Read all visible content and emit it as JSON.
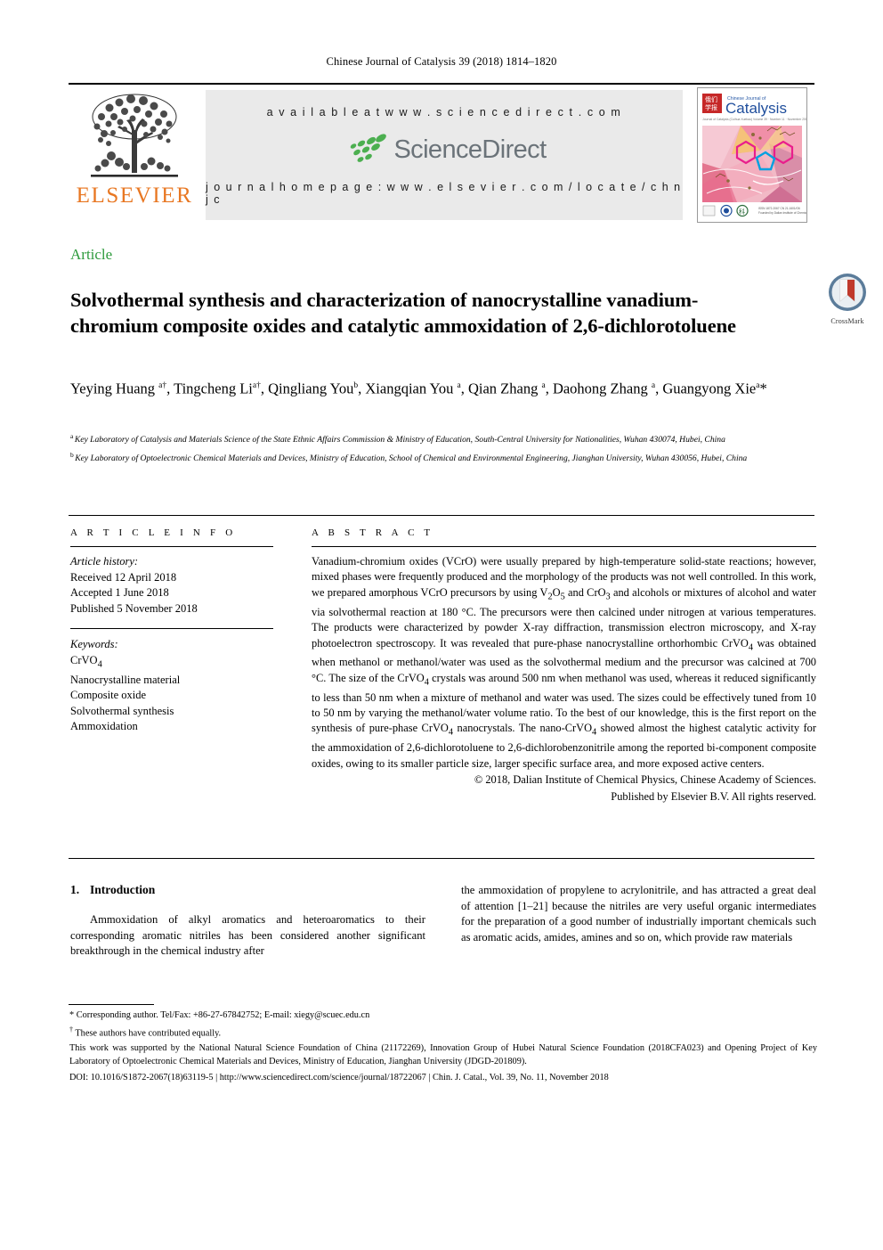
{
  "running_head": "Chinese Journal of Catalysis 39 (2018) 1814–1820",
  "masthead": {
    "publisher_name": "ELSEVIER",
    "available_at": "a v a i l a b l e   a t   w w w . s c i e n c e d i r e c t . c o m",
    "sciencedirect_logo_text": "ScienceDirect",
    "journal_homepage": "j o u r n a l   h o m e p a g e :   w w w . e l s e v i e r . c o m / l o c a t e / c h n j c",
    "cover_journal_title": "Catalysis",
    "cover_journal_kicker": "Chinese Journal of"
  },
  "article_type": "Article",
  "title": "Solvothermal synthesis and characterization of nanocrystalline vanadium-chromium composite oxides and catalytic ammoxidation of 2,6-dichlorotoluene",
  "crossmark_label": "CrossMark",
  "authors_html": "Yeying Huang <sup>a†</sup>, Tingcheng Li<sup>a†</sup>, Qingliang You<sup>b</sup>, Xiangqian You <sup>a</sup>, Qian Zhang <sup>a</sup>, Daohong Zhang <sup>a</sup>, Guangyong Xie<sup>a</sup>*",
  "affiliations": [
    {
      "marker": "a",
      "text": "Key Laboratory of Catalysis and Materials Science of the State Ethnic Affairs Commission & Ministry of Education, South-Central University for Nationalities, Wuhan 430074, Hubei, China"
    },
    {
      "marker": "b",
      "text": "Key Laboratory of Optoelectronic Chemical Materials and Devices, Ministry of Education, School of Chemical and Environmental Engineering, Jianghan University, Wuhan 430056, Hubei, China"
    }
  ],
  "article_info": {
    "heading": "A R T I C L E   I N F O",
    "history_label": "Article history:",
    "history": [
      "Received 12 April 2018",
      "Accepted 1 June 2018",
      "Published 5 November 2018"
    ],
    "keywords_label": "Keywords:",
    "keywords_html": [
      "CrVO<sub>4</sub>",
      "Nanocrystalline material",
      "Composite oxide",
      "Solvothermal synthesis",
      "Ammoxidation"
    ]
  },
  "abstract": {
    "heading": "A B S T R A C T",
    "body_html": "Vanadium-chromium oxides (VCrO) were usually prepared by high-temperature solid-state reactions; however, mixed phases were frequently produced and the morphology of the products was not well controlled. In this work, we prepared amorphous VCrO precursors by using V<sub>2</sub>O<sub>5</sub> and CrO<sub>3</sub> and alcohols or mixtures of alcohol and water via solvothermal reaction at 180 °C. The precursors were then calcined under nitrogen at various temperatures. The products were characterized by powder X-ray diffraction, transmission electron microscopy, and X-ray photoelectron spectroscopy. It was revealed that pure-phase nanocrystalline orthorhombic CrVO<sub>4</sub> was obtained when methanol or methanol/water was used as the solvothermal medium and the precursor was calcined at 700 °C. The size of the CrVO<sub>4</sub> crystals was around 500 nm when methanol was used, whereas it reduced significantly to less than 50 nm when a mixture of methanol and water was used. The sizes could be effectively tuned from 10 to 50 nm by varying the methanol/water volume ratio. To the best of our knowledge, this is the first report on the synthesis of pure-phase CrVO<sub>4</sub> nanocrystals. The nano-CrVO<sub>4</sub> showed almost the highest catalytic activity for the ammoxidation of 2,6-dichlorotoluene to 2,6-dichlorobenzonitrile among the reported bi-component composite oxides, owing to its smaller particle size, larger specific surface area, and more exposed active centers.",
    "copyright_line1": "© 2018, Dalian Institute of Chemical Physics, Chinese Academy of Sciences.",
    "copyright_line2": "Published by Elsevier B.V. All rights reserved."
  },
  "body": {
    "section_number": "1.",
    "section_title": "Introduction",
    "left_paragraph": "Ammoxidation of alkyl aromatics and heteroaromatics to their corresponding aromatic nitriles has been considered another significant breakthrough in the chemical industry after",
    "right_paragraph": "the ammoxidation of propylene to acrylonitrile, and has attracted a great deal of attention [1–21] because the nitriles are very useful organic intermediates for the preparation of a good number of industrially important chemicals such as aromatic acids, amides, amines and so on, which provide raw materials"
  },
  "footnotes": {
    "corresponding_html": "* Corresponding author. Tel/Fax: +86-27-67842752; E-mail: xiegy@scuec.edu.cn",
    "equal_contrib_html": "<sup>†</sup> These authors have contributed equally.",
    "grant": "This work was supported by the National Natural Science Foundation of China (21172269), Innovation Group of Hubei Natural Science Foundation (2018CFA023) and Opening Project of Key Laboratory of Optoelectronic Chemical Materials and Devices, Ministry of Education, Jianghan University (JDGD-201809).",
    "doi_line": "DOI: 10.1016/S1872-2067(18)63119-5 | http://www.sciencedirect.com/science/journal/18722067 | Chin. J. Catal., Vol. 39, No. 11, November 2018"
  },
  "colors": {
    "article_type_green": "#2e9b3d",
    "elsevier_orange": "#E87722",
    "sciencedirect_gray": "#6b7379",
    "sciencedirect_green": "#4caf50",
    "banner_bg": "#eaeaea"
  }
}
